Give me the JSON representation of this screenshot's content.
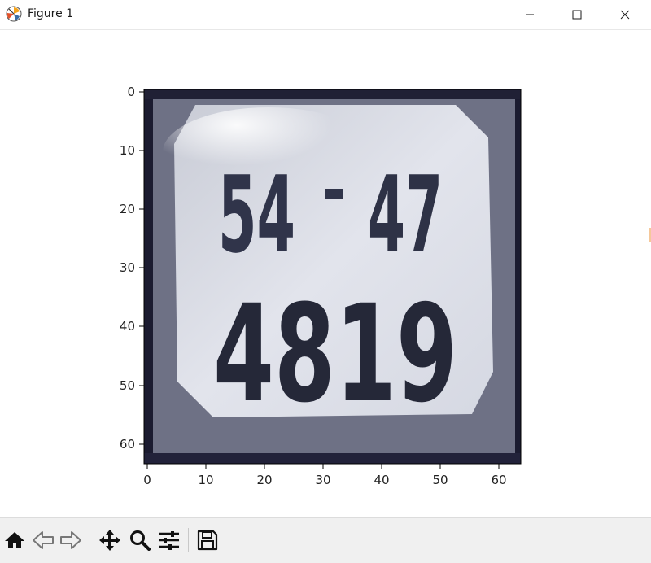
{
  "window": {
    "title": "Figure 1",
    "controls": [
      "minimize",
      "maximize",
      "close"
    ]
  },
  "figure": {
    "image_description": "grayscale license plate crop displayed with matplotlib imshow",
    "plate_text": [
      "54-47",
      "4819"
    ],
    "x_ticks": [
      "0",
      "10",
      "20",
      "30",
      "40",
      "50",
      "60"
    ],
    "y_ticks": [
      "0",
      "10",
      "20",
      "30",
      "40",
      "50",
      "60"
    ],
    "x_range": [
      -0.5,
      63.5
    ],
    "y_range": [
      -0.5,
      63.5
    ]
  },
  "toolbar": {
    "buttons": [
      {
        "name": "home",
        "icon": "home-icon"
      },
      {
        "name": "back",
        "icon": "arrow-left-icon"
      },
      {
        "name": "forward",
        "icon": "arrow-right-icon"
      },
      {
        "name": "pan",
        "icon": "move-icon"
      },
      {
        "name": "zoom",
        "icon": "magnifier-icon"
      },
      {
        "name": "configure-subplots",
        "icon": "sliders-icon"
      },
      {
        "name": "save",
        "icon": "floppy-disk-icon"
      }
    ]
  },
  "colors": {
    "plate_background": "#dcdfe8",
    "plate_frame": "#15152a",
    "plate_text": "#252838",
    "toolbar_background": "#f0f0f0"
  }
}
